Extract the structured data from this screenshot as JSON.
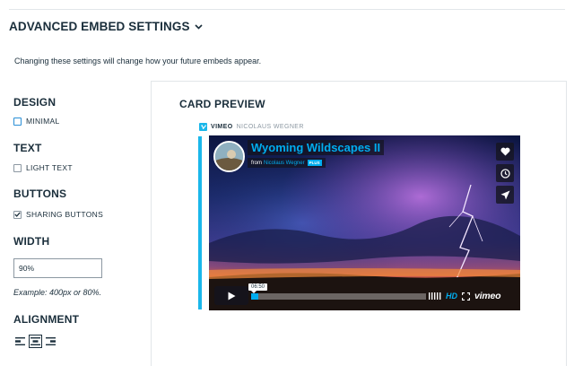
{
  "header": {
    "title": "ADVANCED EMBED SETTINGS",
    "chevron_icon": "chevron-down-icon"
  },
  "intro_text": "Changing these settings will change how your future embeds appear.",
  "settings": {
    "design": {
      "label": "DESIGN",
      "option": "MINIMAL",
      "checked": false
    },
    "text": {
      "label": "TEXT",
      "option": "LIGHT TEXT",
      "checked": false
    },
    "buttons": {
      "label": "BUTTONS",
      "option": "SHARING BUTTONS",
      "checked": true
    },
    "width": {
      "label": "WIDTH",
      "value": "90%",
      "example": "Example: 400px or 80%."
    },
    "alignment": {
      "label": "ALIGNMENT",
      "options": [
        "left",
        "center",
        "right"
      ],
      "selected": "center"
    }
  },
  "preview": {
    "title": "CARD PREVIEW",
    "brand": "VIMEO",
    "owner": "NICOLAUS WEGNER",
    "video": {
      "title": "Wyoming Wildscapes II",
      "from_prefix": "from",
      "author": "Nicolaus Wegner",
      "badge": "PLUS",
      "timecode": "06:50",
      "progress": 0.04,
      "hd_label": "HD",
      "logo_text": "vimeo",
      "side_icons": [
        "heart-icon",
        "clock-icon",
        "send-icon"
      ]
    }
  },
  "colors": {
    "accent": "#1ab7ea",
    "text": "#1a2e3b",
    "muted": "#8c98a2",
    "vimeo_blue": "#00adef"
  }
}
